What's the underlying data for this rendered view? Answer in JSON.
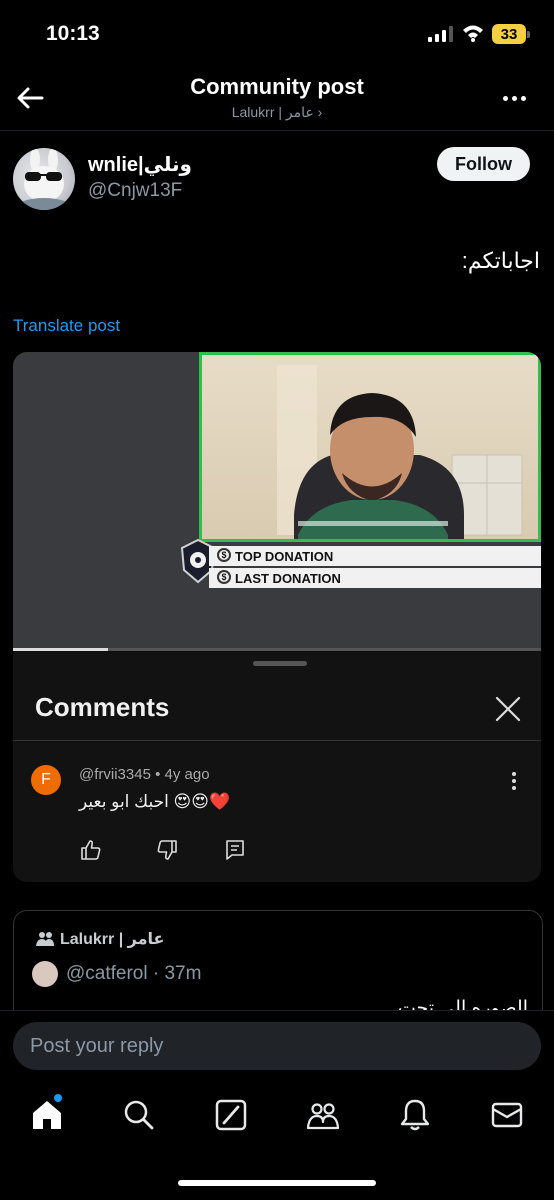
{
  "status": {
    "time": "10:13",
    "battery": "33"
  },
  "header": {
    "title": "Community post",
    "subtitle": "Lalukrr | عامر ›"
  },
  "post": {
    "author_name": "wnlie|ونلي",
    "author_handle": "@Cnjw13F",
    "follow_label": "Follow",
    "text": "اجاباتكم:",
    "translate_label": "Translate post"
  },
  "video": {
    "overlay_top": "TOP DONATION",
    "overlay_last": "LAST DONATION",
    "progress": 0.18
  },
  "comments_panel": {
    "title": "Comments",
    "comment": {
      "avatar_letter": "F",
      "meta": "@frvii3345 • 4y ago",
      "text": "احبك ابو بعير 😍😍❤️"
    }
  },
  "quote": {
    "community": "Lalukrr | عامر",
    "handle": "@catferol · 37m",
    "text": "الصوره الى تحت"
  },
  "reply": {
    "placeholder": "Post your reply"
  },
  "nav": {
    "items": [
      "home-icon",
      "search-icon",
      "grok-icon",
      "communities-icon",
      "notifications-icon",
      "messages-icon"
    ]
  },
  "colors": {
    "accent": "#1d9bf0",
    "background": "#000000",
    "frame": "#2fbf4a"
  }
}
